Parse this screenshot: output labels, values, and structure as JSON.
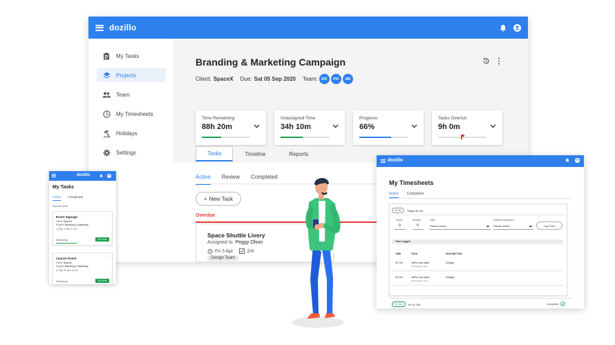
{
  "app": {
    "brand": "dozillo"
  },
  "sidebar": {
    "items": [
      {
        "label": "My Tasks",
        "icon": "clipboard-icon",
        "active": false
      },
      {
        "label": "Projects",
        "icon": "layers-icon",
        "active": true
      },
      {
        "label": "Team",
        "icon": "people-icon",
        "active": false
      },
      {
        "label": "My Timesheets",
        "icon": "clock-icon",
        "active": false
      },
      {
        "label": "Holidays",
        "icon": "beach-umbrella-icon",
        "active": false
      },
      {
        "label": "Settings",
        "icon": "gear-icon",
        "active": false
      }
    ]
  },
  "project": {
    "title": "Branding & Marketing Campaign",
    "client_label": "Client:",
    "client": "SpaceX",
    "due_label": "Due:",
    "due": "Sat 05 Sep 2020",
    "team_label": "Team:",
    "team": [
      "DD",
      "PO",
      "SR"
    ]
  },
  "stats": [
    {
      "label": "Time Remaining",
      "value": "88h 20m",
      "progress": 0.4,
      "color": "#1b9e4b"
    },
    {
      "label": "Unassigned Time",
      "value": "34h 10m",
      "progress": 0.45,
      "color": "#1b9e4b"
    },
    {
      "label": "Progress",
      "value": "66%",
      "progress": 0.66,
      "color": "#2f80ed"
    },
    {
      "label": "Tasks Overrun",
      "value": "9h 0m",
      "progress": 0.0,
      "color": "#e53935"
    }
  ],
  "tabs": [
    "Tasks",
    "Timeline",
    "Reports"
  ],
  "subtabs": [
    "Active",
    "Review",
    "Completed"
  ],
  "new_task": "New Task",
  "overdue": "Overdue",
  "task": {
    "title": "Space Shuttle Livery",
    "assigned_label": "Assigned to:",
    "assigned": "Peggy Olson",
    "date": "Fri 5 Apr",
    "checklist": "2/4",
    "tag": "Design Team"
  },
  "mobile": {
    "title": "My Tasks",
    "tabs": [
      "Active",
      "Completed"
    ],
    "section": "Due this week",
    "cards": [
      {
        "title": "Event Signage",
        "client_label": "Client:",
        "client": "SpaceX",
        "project_label": "Project:",
        "project": "Branding & Marketing",
        "date": "Sep 1 due",
        "checklist": "2/4",
        "remaining": "Remaining",
        "badge": "20h 30m"
      },
      {
        "title": "Launch Event",
        "client_label": "Client:",
        "client": "SpaceX",
        "project_label": "Project:",
        "project": "Branding & Marketing",
        "date": "Sep 11 due",
        "checklist": "0/4",
        "remaining": "Remaining",
        "badge": "10h 30m"
      }
    ]
  },
  "timesheets": {
    "brand": "dozillo",
    "title": "My Timesheets",
    "tabs": [
      "Active",
      "Completed"
    ],
    "date_pill": "0h 0m",
    "date": "Today 06 Oct",
    "hours_label": "Hours",
    "hours": "0",
    "minutes_label": "Minutes",
    "minutes": "0",
    "task_label": "Task",
    "task_placeholder": "Please select",
    "activity_label": "Activity Description",
    "activity_placeholder": "Please select",
    "log_button": "Log Time",
    "logged_header": "Time Logged",
    "columns": [
      "TIME",
      "TASK",
      "DESCRIPTION"
    ],
    "rows": [
      {
        "time": "2h 0m",
        "task": "Jeff's new task",
        "sub": "Test project 1 test",
        "description": "Design"
      },
      {
        "time": "3h 0m",
        "task": "Jeff's new task",
        "sub": "Test project 1 test",
        "description": "Design"
      }
    ],
    "footer_pill": "2h 30m",
    "footer_date": "Fri 01 Oct",
    "complete": "Complete"
  }
}
